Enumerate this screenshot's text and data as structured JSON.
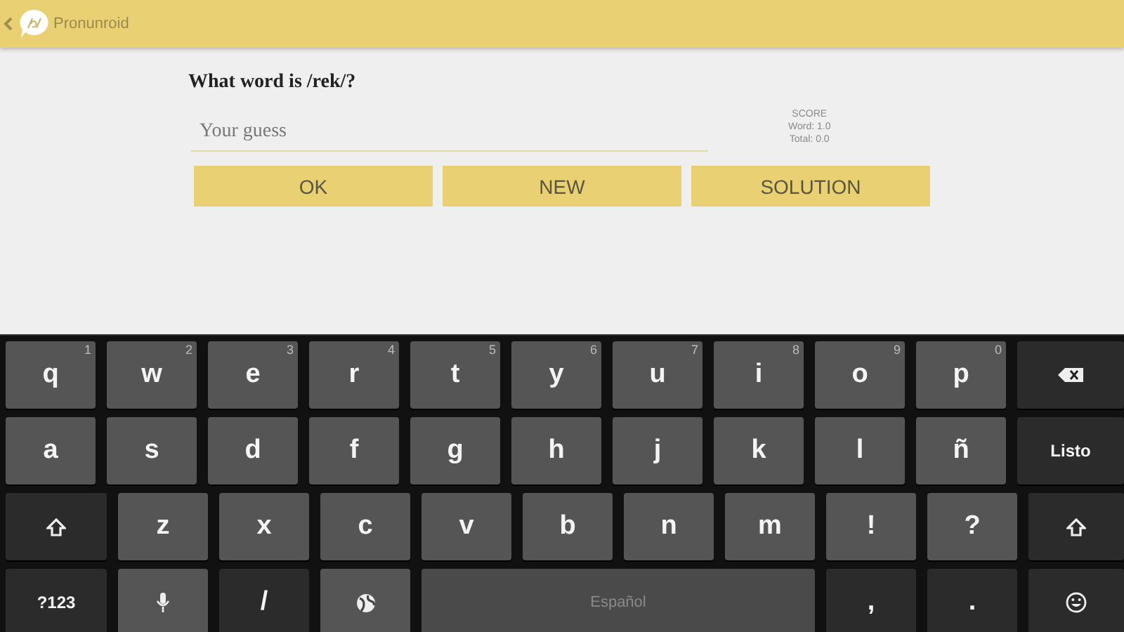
{
  "app_bar": {
    "title": "Pronunroid"
  },
  "question": "What word is /rek/?",
  "guess_field": {
    "placeholder": "Your guess"
  },
  "score": {
    "title": "SCORE",
    "word": "Word: 1.0",
    "total": "Total: 0.0"
  },
  "buttons": [
    "OK",
    "NEW",
    "SOLUTION"
  ],
  "keyboard": {
    "rows": [
      {
        "keys": [
          {
            "kind": "char",
            "label": "q",
            "hint": "1"
          },
          {
            "kind": "char",
            "label": "w",
            "hint": "2"
          },
          {
            "kind": "char",
            "label": "e",
            "hint": "3"
          },
          {
            "kind": "char",
            "label": "r",
            "hint": "4"
          },
          {
            "kind": "char",
            "label": "t",
            "hint": "5"
          },
          {
            "kind": "char",
            "label": "y",
            "hint": "6"
          },
          {
            "kind": "char",
            "label": "u",
            "hint": "7"
          },
          {
            "kind": "char",
            "label": "i",
            "hint": "8"
          },
          {
            "kind": "char",
            "label": "o",
            "hint": "9"
          },
          {
            "kind": "char",
            "label": "p",
            "hint": "0"
          },
          {
            "kind": "backspace"
          }
        ]
      },
      {
        "keys": [
          {
            "kind": "char",
            "label": "a"
          },
          {
            "kind": "char",
            "label": "s"
          },
          {
            "kind": "char",
            "label": "d"
          },
          {
            "kind": "char",
            "label": "f"
          },
          {
            "kind": "char",
            "label": "g"
          },
          {
            "kind": "char",
            "label": "h"
          },
          {
            "kind": "char",
            "label": "j"
          },
          {
            "kind": "char",
            "label": "k"
          },
          {
            "kind": "char",
            "label": "l"
          },
          {
            "kind": "char",
            "label": "ñ"
          },
          {
            "kind": "action",
            "label": "Listo"
          }
        ]
      },
      {
        "keys": [
          {
            "kind": "shift"
          },
          {
            "kind": "char",
            "label": "z"
          },
          {
            "kind": "char",
            "label": "x"
          },
          {
            "kind": "char",
            "label": "c"
          },
          {
            "kind": "char",
            "label": "v"
          },
          {
            "kind": "char",
            "label": "b"
          },
          {
            "kind": "char",
            "label": "n"
          },
          {
            "kind": "char",
            "label": "m"
          },
          {
            "kind": "char",
            "label": "!"
          },
          {
            "kind": "char",
            "label": "?"
          },
          {
            "kind": "shift"
          }
        ]
      },
      {
        "keys": [
          {
            "kind": "action",
            "label": "?123"
          },
          {
            "kind": "mic"
          },
          {
            "kind": "dark",
            "label": "/"
          },
          {
            "kind": "globe"
          },
          {
            "kind": "space",
            "label": "Español"
          },
          {
            "kind": "dark",
            "label": ","
          },
          {
            "kind": "dark",
            "label": "."
          },
          {
            "kind": "emoji"
          }
        ]
      }
    ]
  }
}
